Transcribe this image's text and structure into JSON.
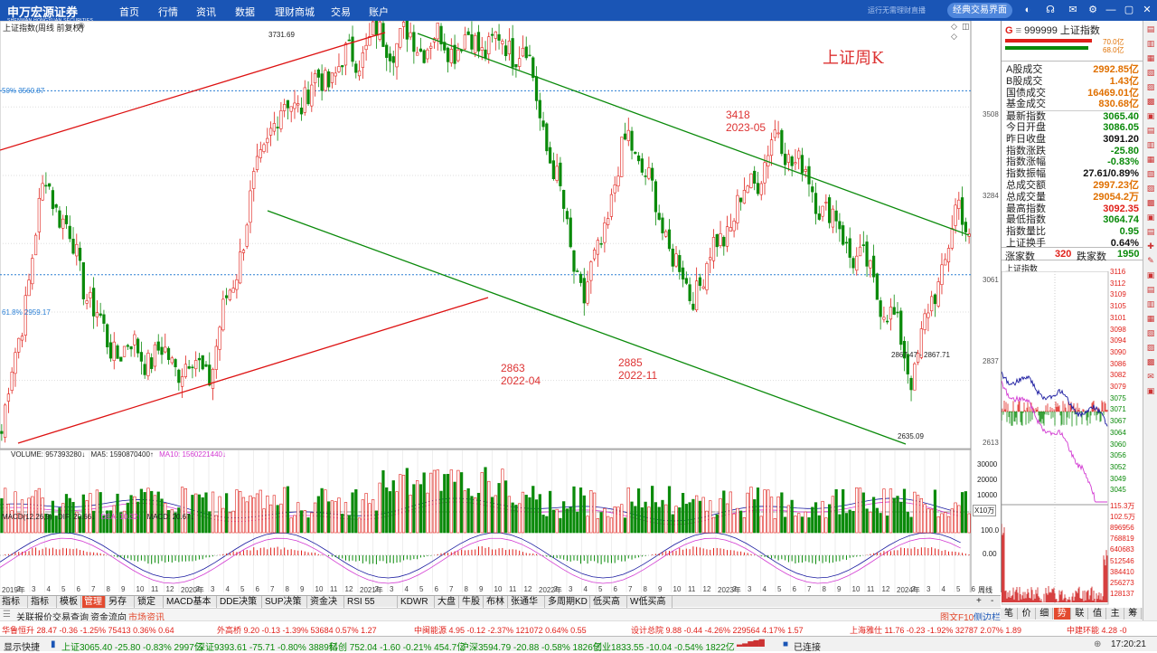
{
  "app": {
    "brand": "申万宏源证券",
    "brand_sub": "SHENWAN HONGYUAN SECURITIES",
    "menu": [
      "首页",
      "行情",
      "资讯",
      "数据",
      "理财商城",
      "交易",
      "账户"
    ],
    "notice": "运行无需理财直播",
    "classic_btn": "经典交易界面",
    "icons": [
      "skin-icon",
      "headset-icon",
      "mail-icon",
      "settings-icon",
      "minimize-icon",
      "restore-icon",
      "close-icon"
    ]
  },
  "chart": {
    "title": "上证指数(周线 前复权)",
    "watermark": "上证周K",
    "fib_top": "50% 3560.87",
    "fib_bottom": "61.8% 2959.17",
    "y_ticks": [
      "3508",
      "3284",
      "3061",
      "2837",
      "2613"
    ],
    "high_label": "3731.69",
    "low_label": "2635.09",
    "range_label": "2867.47 - 2867.71",
    "annotations": [
      {
        "price": "3418",
        "date": "2023-05"
      },
      {
        "price": "2863",
        "date": "2022-04"
      },
      {
        "price": "2885",
        "date": "2022-11"
      }
    ],
    "volume_header": {
      "volume": "VOLUME: 957393280↓",
      "ma5": "MA5: 1590870400↑",
      "ma10": "MA10: 1560221440↓"
    },
    "volume_ticks": [
      "30000",
      "20000",
      "10000"
    ],
    "volume_unit": "X10万",
    "macd_header": {
      "name": "MACD(12,26,9)",
      "dif": "DIF: 20.66↓",
      "dea": "DEA: 10.32↑",
      "macd": "MACD: 20.67↓"
    },
    "macd_ticks": [
      "100.0",
      "0.00"
    ],
    "x_axis": [
      "2019年",
      "2",
      "3",
      "4",
      "5",
      "6",
      "7",
      "8",
      "9",
      "10",
      "11",
      "12",
      "2020年",
      "2",
      "3",
      "4",
      "5",
      "6",
      "7",
      "8",
      "9",
      "10",
      "11",
      "12",
      "2021年",
      "2",
      "3",
      "4",
      "5",
      "6",
      "7",
      "8",
      "9",
      "10",
      "11",
      "12",
      "2022年",
      "2",
      "3",
      "4",
      "5",
      "6",
      "7",
      "8",
      "9",
      "10",
      "11",
      "12",
      "2023年",
      "2",
      "3",
      "4",
      "5",
      "6",
      "7",
      "8",
      "9",
      "10",
      "11",
      "12",
      "2024年",
      "2",
      "3",
      "4",
      "5",
      "6"
    ],
    "period": "周线",
    "chart_data": {
      "type": "candlestick",
      "title": "上证指数(周线 前复权)",
      "x_range": [
        "2019-01",
        "2024-06"
      ],
      "y_range": [
        2613,
        3731.69
      ],
      "key_points": [
        {
          "date": "2019-01",
          "value": 2440
        },
        {
          "date": "2019-04",
          "value": 3288
        },
        {
          "date": "2019-08",
          "value": 2733
        },
        {
          "date": "2020-03",
          "value": 2646
        },
        {
          "date": "2020-07",
          "value": 3458
        },
        {
          "date": "2021-02",
          "value": 3731.69
        },
        {
          "date": "2021-12",
          "value": 3708
        },
        {
          "date": "2022-04",
          "value": 2863
        },
        {
          "date": "2022-07",
          "value": 3424
        },
        {
          "date": "2022-11",
          "value": 2885
        },
        {
          "date": "2023-05",
          "value": 3418
        },
        {
          "date": "2023-12",
          "value": 2882
        },
        {
          "date": "2024-02",
          "value": 2635.09
        },
        {
          "date": "2024-05",
          "value": 3174
        },
        {
          "date": "2024-06",
          "value": 3065.4
        }
      ]
    }
  },
  "panel": {
    "code": "999999",
    "name": "上证指数",
    "bar_top": "70.0亿",
    "bar_bottom": "68.0亿",
    "rows": [
      {
        "k": "A股成交",
        "v": "2992.85亿",
        "c": "org"
      },
      {
        "k": "B股成交",
        "v": "1.43亿",
        "c": "org"
      },
      {
        "k": "国债成交",
        "v": "16469.01亿",
        "c": "org"
      },
      {
        "k": "基金成交",
        "v": "830.68亿",
        "c": "org"
      },
      {
        "k": "最新指数",
        "v": "3065.40",
        "c": "grn"
      },
      {
        "k": "今日开盘",
        "v": "3086.05",
        "c": "grn"
      },
      {
        "k": "昨日收盘",
        "v": "3091.20",
        "c": "blk"
      },
      {
        "k": "指数涨跌",
        "v": "-25.80",
        "c": "grn"
      },
      {
        "k": "指数涨幅",
        "v": "-0.83%",
        "c": "grn"
      },
      {
        "k": "指数振幅",
        "v": "27.61/0.89%",
        "c": "blk"
      },
      {
        "k": "总成交额",
        "v": "2997.23亿",
        "c": "org"
      },
      {
        "k": "总成交量",
        "v": "29054.2万",
        "c": "org"
      },
      {
        "k": "最高指数",
        "v": "3092.35",
        "c": "red"
      },
      {
        "k": "最低指数",
        "v": "3064.74",
        "c": "grn"
      },
      {
        "k": "指数量比",
        "v": "0.95",
        "c": "grn"
      },
      {
        "k": "上证换手",
        "v": "0.64%",
        "c": "blk"
      }
    ],
    "up_label": "涨家数",
    "up": "320",
    "down_label": "跌家数",
    "down": "1950",
    "mini_title": "上证指数",
    "mini_ticks": [
      "3116",
      "3112",
      "3109",
      "3105",
      "3101",
      "3098",
      "3094",
      "3090",
      "3086",
      "3082",
      "3079",
      "3075",
      "3071",
      "3067",
      "3064",
      "3060",
      "3056",
      "3052",
      "3049",
      "3045"
    ],
    "mini_vol_ticks": [
      "115.3万",
      "102.5万",
      "896956",
      "768819",
      "640683",
      "512546",
      "384410",
      "256273",
      "128137"
    ],
    "mini_tabs": [
      "笔",
      "价",
      "细",
      "势",
      "联",
      "值",
      "主",
      "筹"
    ]
  },
  "tabs": [
    "指标A",
    "指标B",
    "模板",
    "管理",
    "另存为",
    "锁定到",
    "MACD基本",
    "DDE决策",
    "SUP决策",
    "资金决策",
    "RSI 55",
    "KDWR",
    "大盘",
    "牛股",
    "布林",
    "张通华量",
    "多周期KD",
    "低买高卖",
    "W低买高卖"
  ],
  "quick": [
    "关联报价",
    "交易查询",
    "资金流向",
    "市场资讯"
  ],
  "right_small": [
    "图文F10",
    "侧边栏"
  ],
  "ticker": [
    "华鲁恒升  28.47  -0.36  -1.25%  75413  0.36%  0.64",
    "外高桥  9.20  -0.13  -1.39%  53684  0.57%  1.27",
    "中闽能源  4.95  -0.12  -2.37%  121072  0.64%  0.55",
    "设计总院  9.88  -0.44  -4.26%  229564  4.17%  1.57",
    "上海雅仕  11.76  -0.23  -1.92%  32787  2.07%  1.89",
    "中建环能  4.28  -0"
  ],
  "status": {
    "quick": "显示快捷",
    "sh": "上证3065.40  -25.80  -0.83%  2997亿",
    "sz": "深证9393.61  -75.71  -0.80%  3889亿",
    "kc": "科创  752.04  -1.60  -0.21%  454.7亿",
    "hs": "沪深3594.79  -20.88  -0.58%  1826亿",
    "cy": "创业1833.55  -10.04  -0.54%  1822亿",
    "conn": "已连接",
    "time": "17:20:21"
  }
}
